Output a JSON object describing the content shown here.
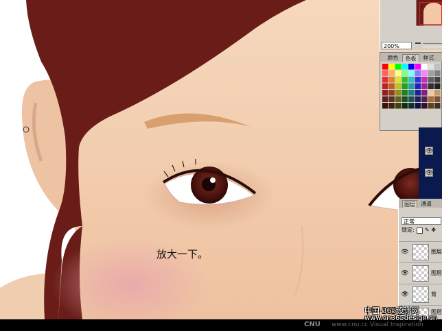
{
  "canvas": {
    "caption": "放大一下。",
    "colors": {
      "hair": "#6a1d18",
      "skin": "#f1c9a6",
      "blush": "#e9a6ac",
      "iris": "#5a1a14",
      "brow": "#d9a06d",
      "background": "#ffffff"
    }
  },
  "navigator": {
    "zoom_value": "200%"
  },
  "swatches": {
    "tabs": [
      "颜色",
      "色板",
      "样式"
    ],
    "active_tab": "色板",
    "colors": [
      "#ff0000",
      "#ffff00",
      "#00ff00",
      "#00ffff",
      "#0000ff",
      "#ff00ff",
      "#ffffff",
      "#e0e0e0",
      "#c0c0c0",
      "#ff6060",
      "#ffb060",
      "#ffff80",
      "#80ff80",
      "#80ffff",
      "#8080ff",
      "#ff80ff",
      "#a0a0a0",
      "#808080",
      "#e03030",
      "#e08030",
      "#e0e030",
      "#30c030",
      "#30c0c0",
      "#3030e0",
      "#c030c0",
      "#606060",
      "#404040",
      "#c02020",
      "#c06020",
      "#c0c020",
      "#20a020",
      "#20a0a0",
      "#2020c0",
      "#a020a0",
      "#303030",
      "#202020",
      "#902020",
      "#904020",
      "#909020",
      "#208020",
      "#208080",
      "#202090",
      "#802080",
      "#f0c8a0",
      "#c89868",
      "#602020",
      "#603020",
      "#606020",
      "#205020",
      "#205050",
      "#202060",
      "#502050",
      "#a07040",
      "#805030",
      "#401010",
      "#402010",
      "#404010",
      "#103010",
      "#103030",
      "#101040",
      "#301030",
      "#604020",
      "#403020"
    ]
  },
  "layers": {
    "tabs": [
      "图层",
      "通道"
    ],
    "blend_mode": "正常",
    "lock_label": "锁定:",
    "items": [
      {
        "name": "图层"
      },
      {
        "name": "图层"
      },
      {
        "name": "背"
      },
      {
        "name": "图层"
      }
    ]
  },
  "footer": {
    "logo": "CNU",
    "url": "www.cnu.cc  Visual Inspiration",
    "watermark_title": "中国·365设计网",
    "watermark_url": "www.cn365design.cn"
  },
  "icons": {
    "eye": "eye-icon",
    "brush": "brush-icon",
    "move": "move-icon",
    "lock": "lock-icon"
  }
}
